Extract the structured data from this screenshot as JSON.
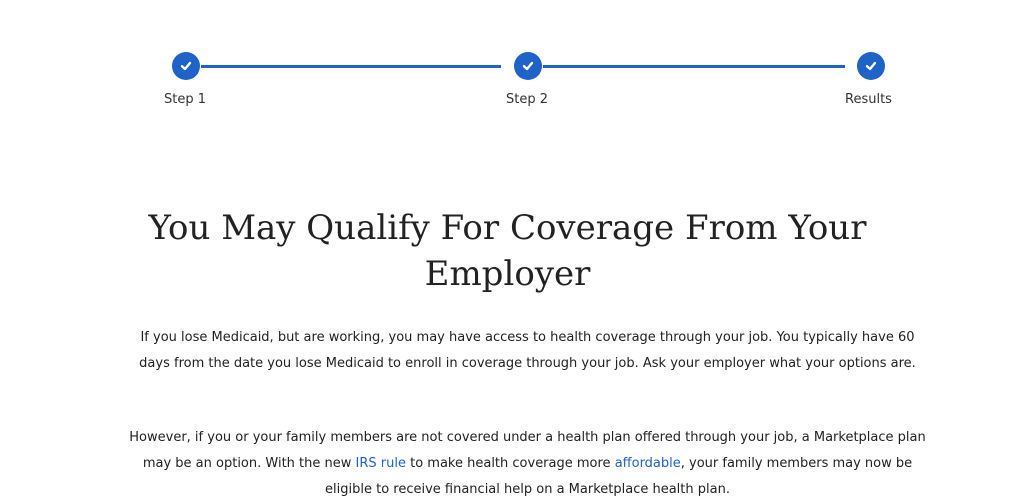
{
  "stepper": {
    "steps": [
      {
        "label": "Step 1",
        "completed": true
      },
      {
        "label": "Step 2",
        "completed": true
      },
      {
        "label": "Results",
        "completed": true
      }
    ],
    "accent_color": "#1f62c8"
  },
  "main": {
    "title": "You May Qualify For Coverage From Your Employer",
    "paragraph1": "If you lose Medicaid, but are working, you may have access to health coverage through your job. You typically have 60 days from the date you lose Medicaid to enroll in coverage through your job. Ask your employer what your options are.",
    "paragraph2": {
      "part1": "However, if you or your family members are not covered under a health plan offered through your job, a Marketplace plan may be an option. With the new ",
      "link1": "IRS rule",
      "part2": " to make health coverage more ",
      "link2": "affordable",
      "part3": ", your family members may now be eligible to receive financial help on a Marketplace health plan."
    }
  }
}
